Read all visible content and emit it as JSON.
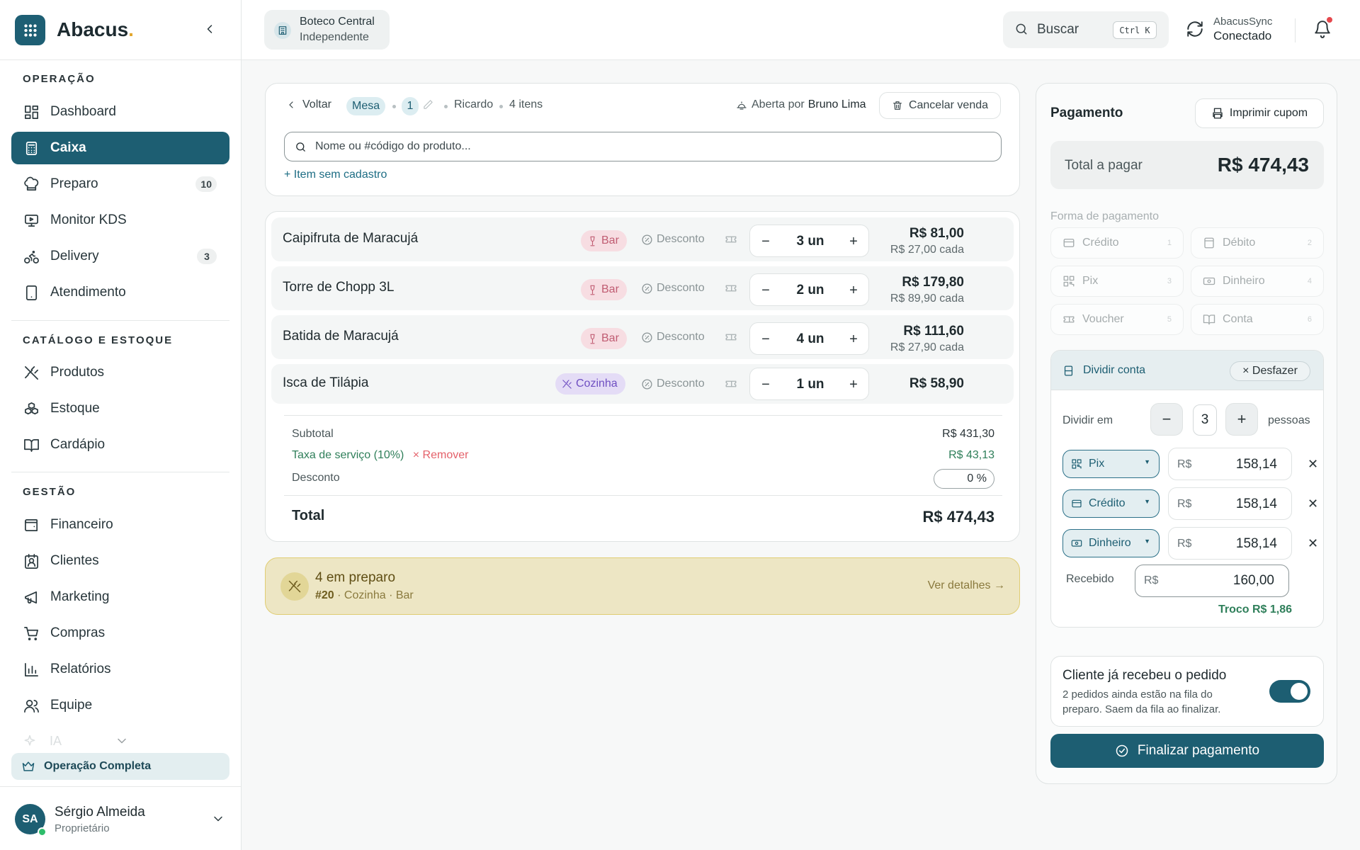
{
  "brand": {
    "name": "Abacus",
    "dot": "."
  },
  "nav": {
    "sections": [
      "OPERAÇÃO",
      "CATÁLOGO E ESTOQUE",
      "GESTÃO"
    ],
    "items": [
      {
        "label": "Dashboard",
        "icon": "dashboard-icon"
      },
      {
        "label": "Caixa",
        "icon": "calculator-icon",
        "active": true
      },
      {
        "label": "Preparo",
        "icon": "chef-hat-icon",
        "badge": "10"
      },
      {
        "label": "Monitor KDS",
        "icon": "monitor-icon"
      },
      {
        "label": "Delivery",
        "icon": "bike-icon",
        "badge": "3"
      },
      {
        "label": "Atendimento",
        "icon": "tablet-icon"
      },
      {
        "label": "Produtos",
        "icon": "utensils-icon"
      },
      {
        "label": "Estoque",
        "icon": "boxes-icon"
      },
      {
        "label": "Cardápio",
        "icon": "book-open-icon"
      },
      {
        "label": "Financeiro",
        "icon": "wallet-icon"
      },
      {
        "label": "Clientes",
        "icon": "contact-icon"
      },
      {
        "label": "Marketing",
        "icon": "megaphone-icon"
      },
      {
        "label": "Compras",
        "icon": "cart-icon"
      },
      {
        "label": "Relatórios",
        "icon": "bar-chart-icon"
      },
      {
        "label": "Equipe",
        "icon": "users-icon"
      }
    ],
    "faded_label": "IA",
    "plan_label": "Operação Completa"
  },
  "user": {
    "initials": "SA",
    "name": "Sérgio Almeida",
    "role": "Proprietário"
  },
  "topbar": {
    "store_name": "Boteco Central",
    "store_type": "Independente",
    "search_label": "Buscar",
    "search_kbd": "Ctrl K",
    "sync_name": "AbacusSync",
    "sync_status": "Conectado"
  },
  "order": {
    "back_label": "Voltar",
    "table_label": "Mesa",
    "table_number": "1",
    "waiter": "Ricardo",
    "items_count": "4 itens",
    "opened_by_label": "Aberta por",
    "opened_by": "Bruno Lima",
    "cancel_label": "Cancelar venda",
    "search_placeholder": "Nome ou #código do produto...",
    "add_item_label": "+ Item sem cadastro"
  },
  "items": [
    {
      "name": "Caipifruta de Maracujá",
      "tag": "Bar",
      "discount": "Desconto",
      "qty": "3 un",
      "total": "R$ 81,00",
      "each": "R$ 27,00 cada"
    },
    {
      "name": "Torre de Chopp 3L",
      "tag": "Bar",
      "discount": "Desconto",
      "qty": "2 un",
      "total": "R$ 179,80",
      "each": "R$ 89,90 cada"
    },
    {
      "name": "Batida de Maracujá",
      "tag": "Bar",
      "discount": "Desconto",
      "qty": "4 un",
      "total": "R$ 111,60",
      "each": "R$ 27,90 cada"
    },
    {
      "name": "Isca de Tilápia",
      "tag": "Cozinha",
      "discount": "Desconto",
      "qty": "1 un",
      "total": "R$ 58,90",
      "each": ""
    }
  ],
  "totals": {
    "subtotal_label": "Subtotal",
    "subtotal": "R$ 431,30",
    "service_label": "Taxa de serviço (10%)",
    "remove_label": "× Remover",
    "service": "R$ 43,13",
    "discount_label": "Desconto",
    "discount": "0 %",
    "total_label": "Total",
    "total": "R$ 474,43"
  },
  "prep": {
    "title": "4 em preparo",
    "order_no": "#20",
    "stations": " · Cozinha · Bar",
    "details_label": "Ver detalhes →"
  },
  "payment": {
    "title": "Pagamento",
    "print_label": "Imprimir cupom",
    "total_label": "Total a pagar",
    "total": "R$ 474,43",
    "method_label": "Forma de pagamento",
    "methods": [
      {
        "label": "Crédito",
        "key": "1",
        "icon": "credit-card-icon"
      },
      {
        "label": "Débito",
        "key": "2",
        "icon": "debit-card-icon"
      },
      {
        "label": "Pix",
        "key": "3",
        "icon": "qr-code-icon"
      },
      {
        "label": "Dinheiro",
        "key": "4",
        "icon": "banknote-icon"
      },
      {
        "label": "Voucher",
        "key": "5",
        "icon": "ticket-icon"
      },
      {
        "label": "Conta",
        "key": "6",
        "icon": "book-icon"
      }
    ],
    "split": {
      "title": "Dividir conta",
      "undo_label": "× Desfazer",
      "divide_label": "Dividir em",
      "people": "3",
      "people_label": "pessoas",
      "currency": "R$",
      "rows": [
        {
          "method": "Pix",
          "amount": "158,14"
        },
        {
          "method": "Crédito",
          "amount": "158,14"
        },
        {
          "method": "Dinheiro",
          "amount": "158,14"
        }
      ],
      "received_label": "Recebido",
      "received": "160,00",
      "change": "Troco R$ 1,86"
    },
    "customer_title": "Cliente já recebeu o pedido",
    "customer_sub": "2 pedidos ainda estão na fila do preparo. Saem da fila ao finalizar.",
    "customer_toggle_on": true,
    "finish_label": "Finalizar pagamento"
  },
  "colors": {
    "primary": "#1d5e72",
    "accent": "#e2a72e",
    "success": "#2f7f5a",
    "danger": "#e5484d"
  }
}
